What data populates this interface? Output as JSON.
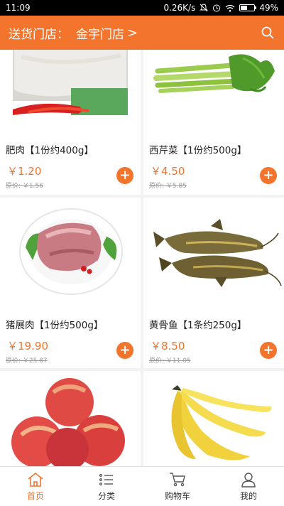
{
  "status_bar": {
    "time": "11:09",
    "network_speed": "0.26K/s",
    "battery_percent": "49%",
    "battery_level": 0.49,
    "icons": [
      "mute-icon",
      "alarm-icon",
      "wifi-icon",
      "battery-icon"
    ]
  },
  "header": {
    "prefix": "送货门店：",
    "store_name": "金宇门店",
    "chevron": ">",
    "search_icon": "search-icon"
  },
  "products": [
    {
      "name": "肥肉【1份约400g】",
      "price": "￥1.20",
      "original_price": "原价: ￥1.56",
      "image": "pork-fat-image"
    },
    {
      "name": "西芹菜【1份约500g】",
      "price": "￥4.50",
      "original_price": "原价: ￥5.85",
      "image": "celery-image"
    },
    {
      "name": "猪展肉【1份约500g】",
      "price": "￥19.90",
      "original_price": "原价: ￥25.87",
      "image": "pork-shank-image"
    },
    {
      "name": "黄骨鱼【1条约250g】",
      "price": "￥8.50",
      "original_price": "原价: ￥11.05",
      "image": "catfish-image"
    },
    {
      "name": "",
      "price": "",
      "original_price": "",
      "image": "apples-image"
    },
    {
      "name": "",
      "price": "",
      "original_price": "",
      "image": "bananas-image"
    }
  ],
  "add_button": "+",
  "tabbar": {
    "accent": "#f2742d",
    "tabs": [
      {
        "label": "首页",
        "icon": "home-icon",
        "active": true
      },
      {
        "label": "分类",
        "icon": "list-icon",
        "active": false
      },
      {
        "label": "购物车",
        "icon": "cart-icon",
        "active": false
      },
      {
        "label": "我的",
        "icon": "user-icon",
        "active": false
      }
    ]
  }
}
